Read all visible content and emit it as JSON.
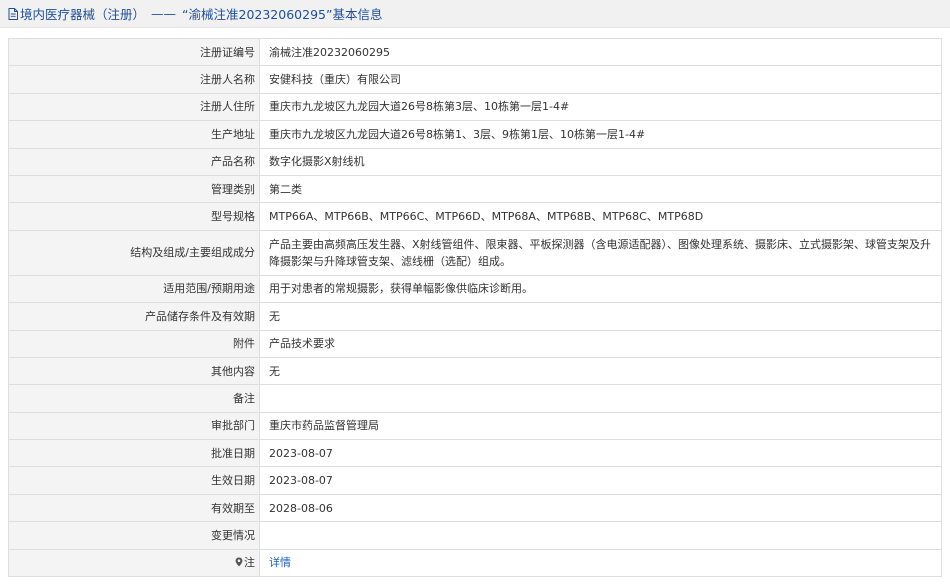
{
  "header": {
    "section": "境内医疗器械（注册）",
    "separator": "——",
    "title": "“渝械注准20232060295”基本信息"
  },
  "rows": [
    {
      "label": "注册证编号",
      "value": "渝械注准20232060295"
    },
    {
      "label": "注册人名称",
      "value": "安健科技（重庆）有限公司"
    },
    {
      "label": "注册人住所",
      "value": "重庆市九龙坡区九龙园大道26号8栋第3层、10栋第一层1-4#"
    },
    {
      "label": "生产地址",
      "value": "重庆市九龙坡区九龙园大道26号8栋第1、3层、9栋第1层、10栋第一层1-4#"
    },
    {
      "label": "产品名称",
      "value": "数字化摄影X射线机"
    },
    {
      "label": "管理类别",
      "value": "第二类"
    },
    {
      "label": "型号规格",
      "value": "MTP66A、MTP66B、MTP66C、MTP66D、MTP68A、MTP68B、MTP68C、MTP68D"
    },
    {
      "label": "结构及组成/主要组成成分",
      "value": "产品主要由高频高压发生器、X射线管组件、限束器、平板探测器（含电源适配器）、图像处理系统、摄影床、立式摄影架、球管支架及升降摄影架与升降球管支架、滤线栅（选配）组成。"
    },
    {
      "label": "适用范围/预期用途",
      "value": "用于对患者的常规摄影，获得单幅影像供临床诊断用。"
    },
    {
      "label": "产品储存条件及有效期",
      "value": "无"
    },
    {
      "label": "附件",
      "value": "产品技术要求"
    },
    {
      "label": "其他内容",
      "value": "无"
    },
    {
      "label": "备注",
      "value": ""
    },
    {
      "label": "审批部门",
      "value": "重庆市药品监督管理局"
    },
    {
      "label": "批准日期",
      "value": "2023-08-07"
    },
    {
      "label": "生效日期",
      "value": "2023-08-07"
    },
    {
      "label": "有效期至",
      "value": "2028-08-06"
    },
    {
      "label": "变更情况",
      "value": ""
    }
  ],
  "note": {
    "label": "注",
    "icon": "pin-icon",
    "link_text": "详情"
  },
  "colors": {
    "header_text": "#1f4e9c",
    "link": "#1f5fb4",
    "label_bg": "#f4f4f4",
    "border": "#dedede"
  }
}
